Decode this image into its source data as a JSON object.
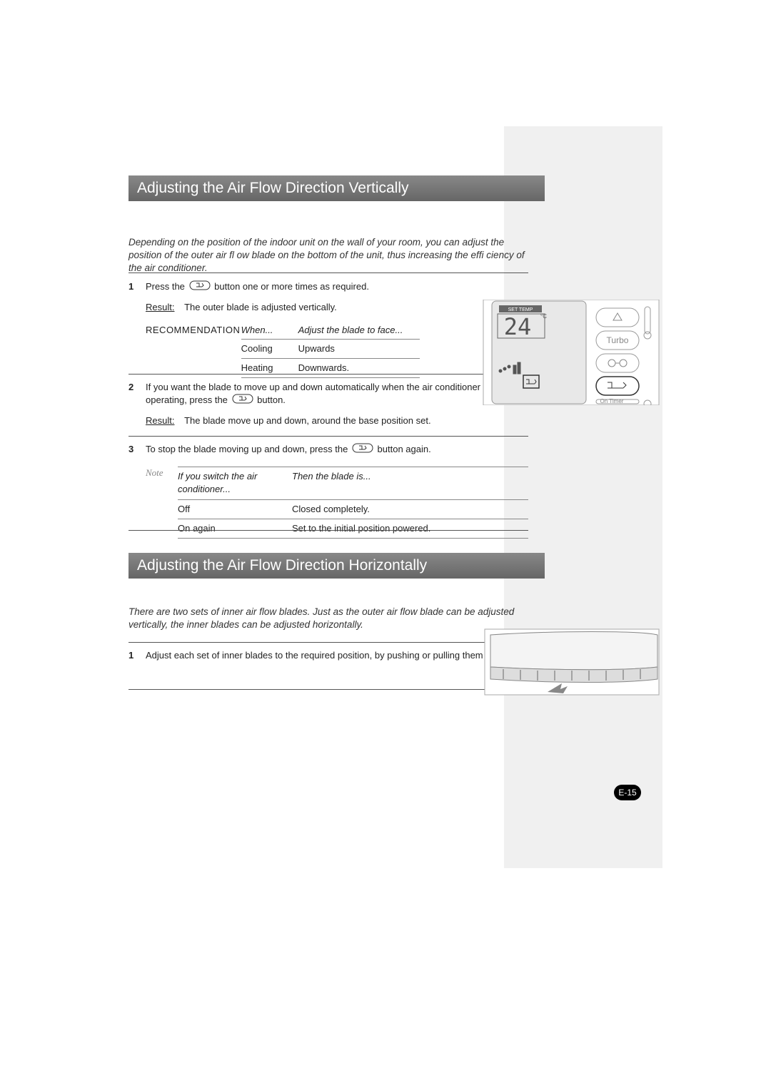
{
  "heading1": "Adjusting the Air Flow Direction Vertically",
  "heading2": "Adjusting the Air Flow Direction Horizontally",
  "intro1": "Depending on the position of the indoor unit on the wall of your room, you can adjust the position of the outer air ﬂ ow blade on the bottom of the unit, thus increasing the efﬁ ciency of the air conditioner.",
  "intro2": "There are two sets of inner air ﬂow blades. Just as the outer air ﬂow blade can be adjusted vertically, the inner blades can be adjusted horizontally.",
  "step1": {
    "num": "1",
    "text_before": "Press the",
    "text_after": "button one or more times as required.",
    "result_label": "Result:",
    "result_text": "The outer blade is adjusted vertically."
  },
  "recommendation": {
    "label": "RECOMMENDATION",
    "hdr_when": "When...",
    "hdr_adj": "Adjust the blade to face...",
    "rows": [
      {
        "when": "Cooling",
        "adj": "Upwards"
      },
      {
        "when": "Heating",
        "adj": "Downwards."
      }
    ]
  },
  "step2": {
    "num": "2",
    "text_before": "If you want the blade to move up and down automatically when the air conditioner is operating, press the",
    "text_after": "button.",
    "result_label": "Result:",
    "result_text": "The blade move up and down, around the base position set."
  },
  "step3": {
    "num": "3",
    "text_before": "To stop the blade moving up and down, press the",
    "text_after": "button again."
  },
  "note": {
    "label": "Note",
    "hdr_state": "If you switch the air conditioner...",
    "hdr_blade": "Then the blade is...",
    "rows": [
      {
        "state": "Off",
        "blade": "Closed completely."
      },
      {
        "state": "On again",
        "blade": "Set to the initial position powered."
      }
    ]
  },
  "stepH1": {
    "num": "1",
    "text": "Adjust each set of inner blades to the required position, by pushing or pulling them sideways."
  },
  "remote": {
    "set_temp_label": "SET TEMP",
    "temp_value": "24",
    "temp_unit": "°C",
    "turbo": "Turbo",
    "on_timer": "On Timer"
  },
  "page_num": "E-15"
}
